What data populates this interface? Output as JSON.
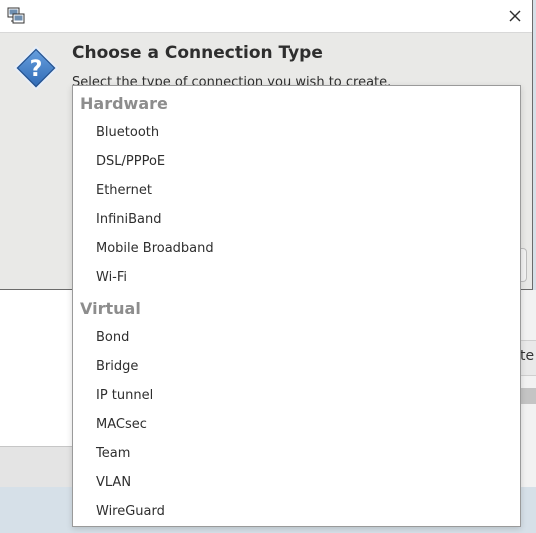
{
  "dialog": {
    "title": "Choose a Connection Type",
    "subtitle": "Select the type of connection you wish to create."
  },
  "background": {
    "partial_label": "te"
  },
  "menu": {
    "sections": [
      {
        "label": "Hardware",
        "items": [
          "Bluetooth",
          "DSL/PPPoE",
          "Ethernet",
          "InfiniBand",
          "Mobile Broadband",
          "Wi-Fi"
        ]
      },
      {
        "label": "Virtual",
        "items": [
          "Bond",
          "Bridge",
          "IP tunnel",
          "MACsec",
          "Team",
          "VLAN",
          "WireGuard"
        ]
      }
    ]
  },
  "icons": {
    "app": "network-connections-icon",
    "close": "close-icon",
    "dialog": "question-icon"
  },
  "colors": {
    "dialog_bg": "#e9e9e7",
    "question_icon": "#3a7bc8",
    "section_text": "#8d8d8d"
  }
}
